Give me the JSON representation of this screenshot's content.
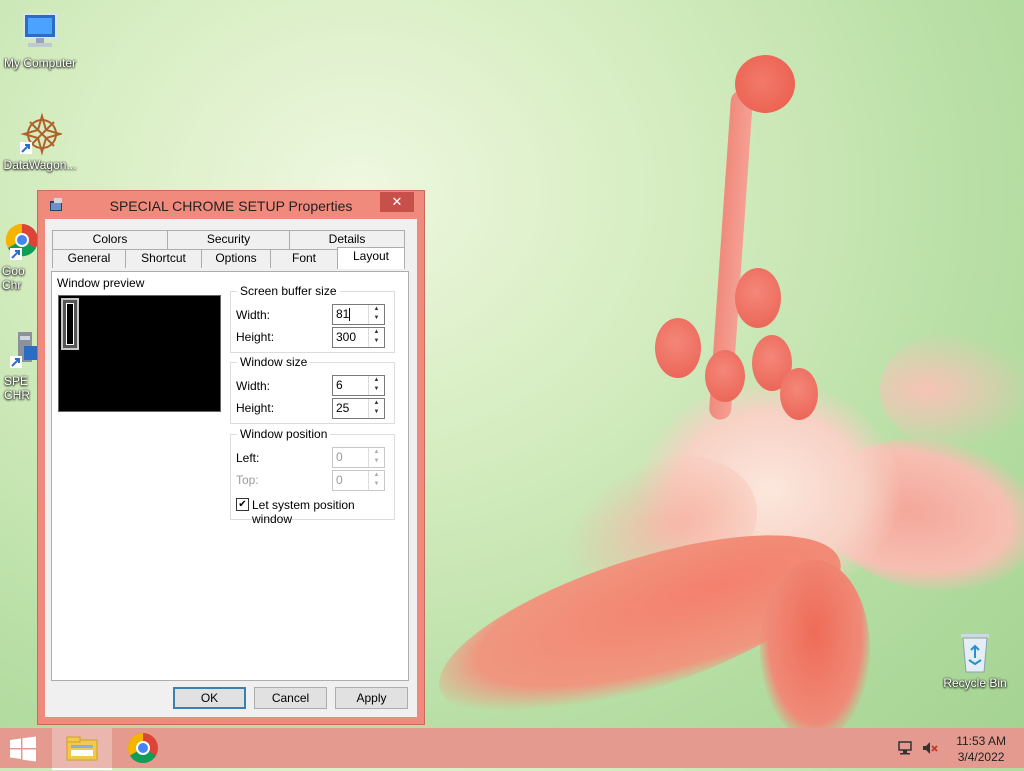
{
  "desktop": {
    "icons": [
      {
        "label": "My Computer",
        "icon": "computer-icon"
      },
      {
        "label": "DataWagon...",
        "icon": "datawagon-icon"
      },
      {
        "label": "Goo Chr",
        "icon": "chrome-icon"
      },
      {
        "label": "SPE CHR",
        "icon": "console-shortcut-icon"
      },
      {
        "label": "Recycle Bin",
        "icon": "recycle-bin-icon"
      }
    ]
  },
  "dialog": {
    "title": "SPECIAL CHROME SETUP Properties",
    "close_label": "✕",
    "tabs_row1": [
      "Colors",
      "Security",
      "Details"
    ],
    "tabs_row2": [
      "General",
      "Shortcut",
      "Options",
      "Font",
      "Layout"
    ],
    "active_tab": "Layout",
    "window_preview_label": "Window preview",
    "screen_buffer": {
      "title": "Screen buffer size",
      "width_label": "Width:",
      "width": "81",
      "height_label": "Height:",
      "height": "300"
    },
    "window_size": {
      "title": "Window size",
      "width_label": "Width:",
      "width": "6",
      "height_label": "Height:",
      "height": "25"
    },
    "window_position": {
      "title": "Window position",
      "left_label": "Left:",
      "left": "0",
      "top_label": "Top:",
      "top": "0",
      "let_system_label": "Let system position window",
      "let_system_checked": true
    },
    "buttons": {
      "ok": "OK",
      "cancel": "Cancel",
      "apply": "Apply"
    }
  },
  "taskbar": {
    "time": "11:53 AM",
    "date": "3/4/2022",
    "apps": [
      "file-explorer-icon",
      "chrome-icon"
    ]
  }
}
